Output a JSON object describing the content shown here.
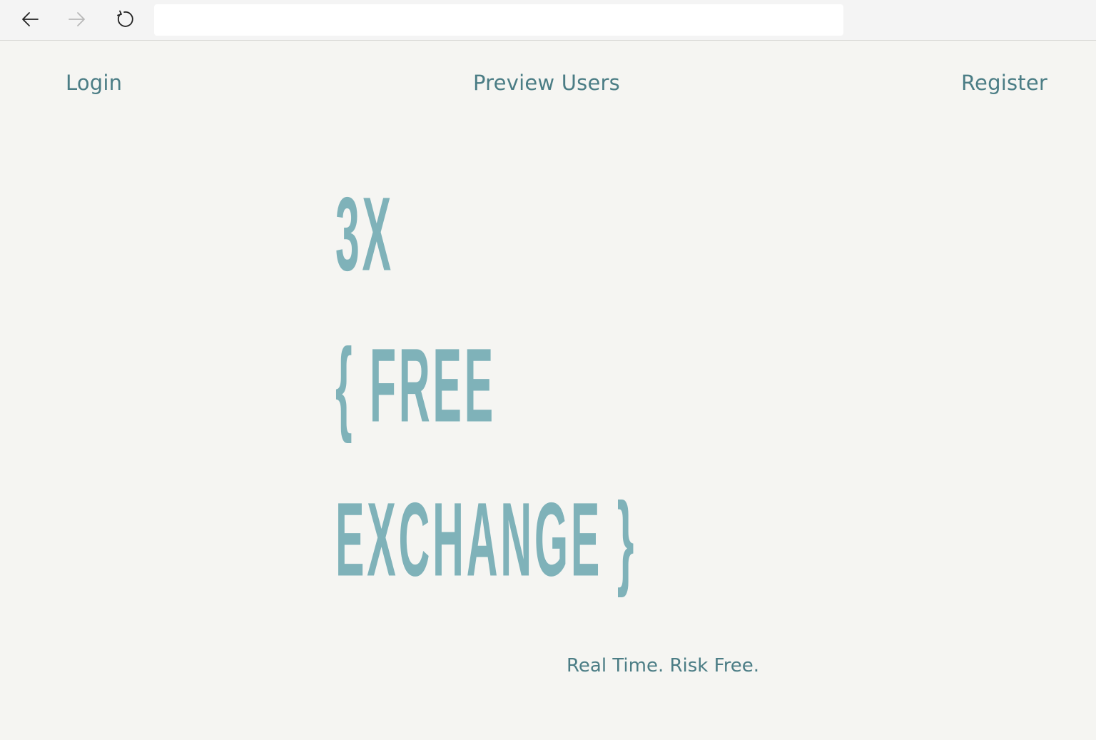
{
  "browser": {
    "address_value": "",
    "back_icon": "arrow-left-icon",
    "forward_icon": "arrow-right-icon",
    "reload_icon": "reload-icon"
  },
  "nav": {
    "login": "Login",
    "preview_users": "Preview Users",
    "register": "Register"
  },
  "hero": {
    "line1": "3X",
    "line2": "{ FREE",
    "line3": "EXCHANGE }",
    "tagline": "Real Time. Risk Free."
  },
  "colors": {
    "background": "#f5f5f2",
    "link": "#4b7d85",
    "logo": "#7fb2b9"
  }
}
